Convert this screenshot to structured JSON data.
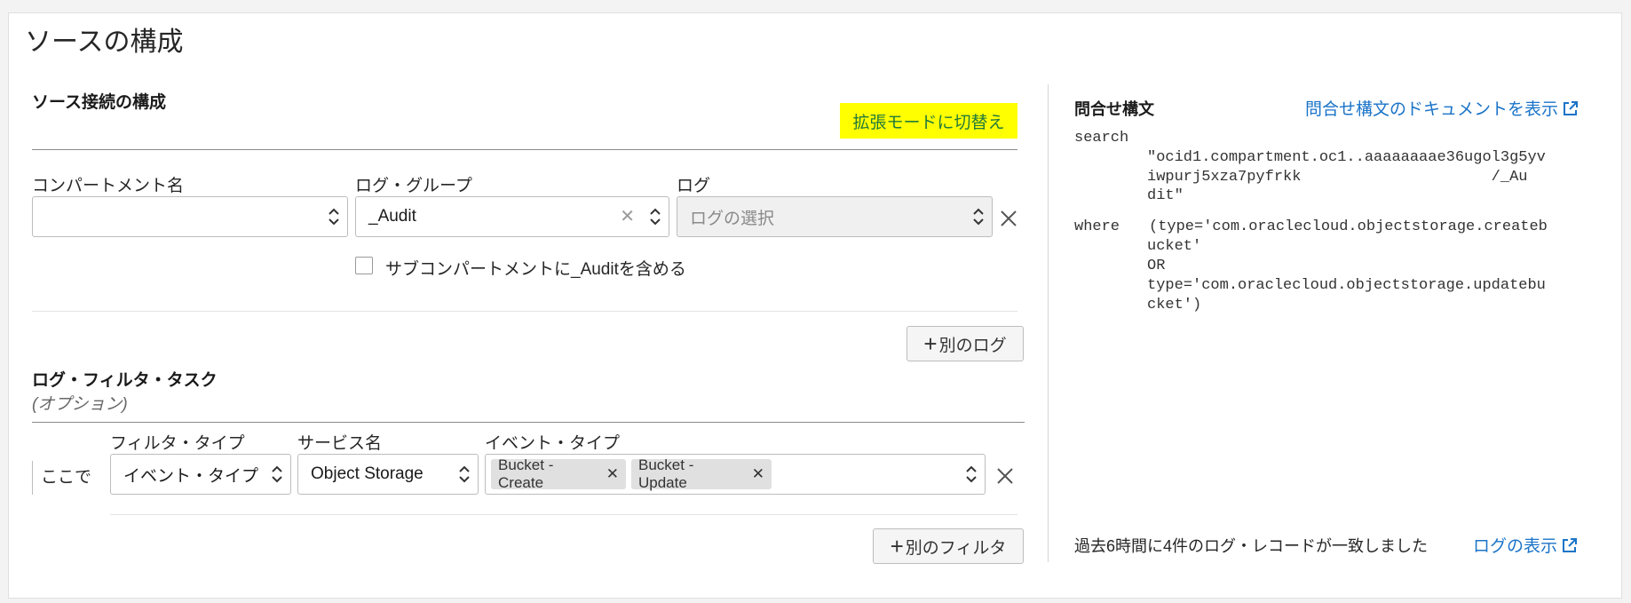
{
  "page": {
    "title": "ソースの構成"
  },
  "source": {
    "heading": "ソース接続の構成",
    "advanced_mode_button": "拡張モードに切替え",
    "compartment_label": "コンパートメント名",
    "compartment_value": "",
    "log_group_label": "ログ・グループ",
    "log_group_value": "_Audit",
    "log_label": "ログ",
    "log_placeholder": "ログの選択",
    "include_sub_checkbox_label": "サブコンパートメントに_Auditを含める",
    "add_log_button": "別のログ"
  },
  "filters": {
    "heading": "ログ・フィルタ・タスク",
    "optional": "(オプション)",
    "here_label": "ここで",
    "filter_type_label": "フィルタ・タイプ",
    "filter_type_value": "イベント・タイプ",
    "service_label": "サービス名",
    "service_value": "Object Storage",
    "event_type_label": "イベント・タイプ",
    "event_chips": [
      "Bucket - Create",
      "Bucket - Update"
    ],
    "add_filter_button": "別のフィルタ"
  },
  "query": {
    "heading": "問合せ構文",
    "docs_link": "問合せ構文のドキュメントを表示",
    "search_keyword": "search",
    "search_line1": "\"ocid1.compartment.oc1..aaaaaaaae36ugol3g5yv",
    "search_line2": "iwpurj5xza7pyfrkk                     /_Au",
    "search_line3": "dit\"",
    "where_keyword": "where",
    "where_line1": "(type='com.oraclecloud.objectstorage.createb",
    "where_line2": "ucket'",
    "where_line3": "OR",
    "where_line4": "type='com.oraclecloud.objectstorage.updatebu",
    "where_line5": "cket')",
    "match_text": "過去6時間に4件のログ・レコードが一致しました",
    "view_logs_link": "ログの表示"
  },
  "colors": {
    "highlight": "#ffff00",
    "link": "#1a73c8",
    "advanced_text": "#227a3a"
  }
}
